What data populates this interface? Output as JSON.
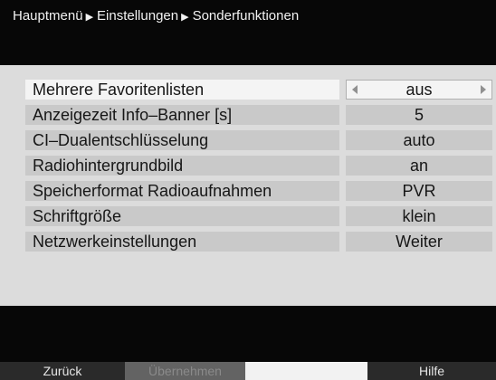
{
  "breadcrumb": [
    "Hauptmenü",
    "Einstellungen",
    "Sonderfunktionen"
  ],
  "settings": [
    {
      "label": "Mehrere Favoritenlisten",
      "value": "aus"
    },
    {
      "label": "Anzeigezeit Info–Banner [s]",
      "value": "5"
    },
    {
      "label": "CI–Dualentschlüsselung",
      "value": "auto"
    },
    {
      "label": "Radiohintergrundbild",
      "value": "an"
    },
    {
      "label": "Speicherformat Radioaufnahmen",
      "value": "PVR"
    },
    {
      "label": "Schriftgröße",
      "value": "klein"
    },
    {
      "label": "Netzwerkeinstellungen",
      "value": "Weiter"
    }
  ],
  "footer": {
    "back": "Zurück",
    "apply": "Übernehmen",
    "blank": "",
    "help": "Hilfe"
  }
}
